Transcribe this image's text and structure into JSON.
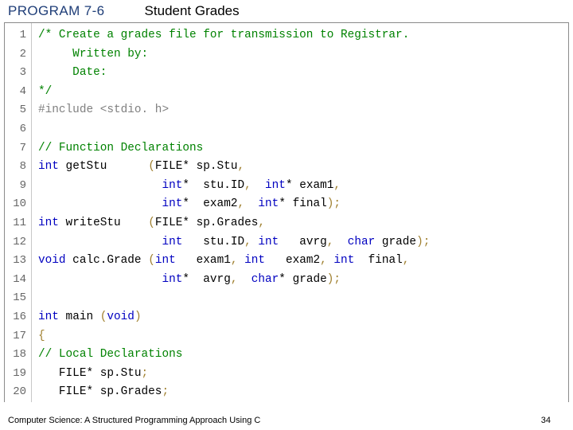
{
  "header": {
    "program_label": "PROGRAM 7-6",
    "title": "Student Grades"
  },
  "code": {
    "line_count": 20,
    "lines": [
      {
        "n": 1,
        "cls": "cmt",
        "text": "/* Create a grades file for transmission to Registrar."
      },
      {
        "n": 2,
        "cls": "cmt",
        "text": "     Written by:"
      },
      {
        "n": 3,
        "cls": "cmt",
        "text": "     Date:"
      },
      {
        "n": 4,
        "cls": "cmt",
        "text": "*/"
      },
      {
        "n": 5,
        "cls": "inc",
        "text": "#include <stdio. h>"
      },
      {
        "n": 6,
        "cls": "",
        "text": ""
      },
      {
        "n": 7,
        "cls": "cmt",
        "text": "// Function Declarations"
      },
      {
        "n": 8,
        "cls": "",
        "html": "<span class='kw'>int</span> getStu      <span class='pn'>(</span>FILE* sp.Stu<span class='pn'>,</span>"
      },
      {
        "n": 9,
        "cls": "",
        "html": "                  <span class='kw'>int</span>*  stu.ID<span class='pn'>,</span>  <span class='kw'>int</span>* exam1<span class='pn'>,</span>"
      },
      {
        "n": 10,
        "cls": "",
        "html": "                  <span class='kw'>int</span>*  exam2<span class='pn'>,</span>  <span class='kw'>int</span>* final<span class='pn'>);</span>"
      },
      {
        "n": 11,
        "cls": "",
        "html": "<span class='kw'>int</span> writeStu    <span class='pn'>(</span>FILE* sp.Grades<span class='pn'>,</span>"
      },
      {
        "n": 12,
        "cls": "",
        "html": "                  <span class='kw'>int</span>   stu.ID<span class='pn'>,</span> <span class='kw'>int</span>   avrg<span class='pn'>,</span>  <span class='kw'>char</span> grade<span class='pn'>);</span>"
      },
      {
        "n": 13,
        "cls": "",
        "html": "<span class='kw'>void</span> calc.Grade <span class='pn'>(</span><span class='kw'>int</span>   exam1<span class='pn'>,</span> <span class='kw'>int</span>   exam2<span class='pn'>,</span> <span class='kw'>int</span>  final<span class='pn'>,</span>"
      },
      {
        "n": 14,
        "cls": "",
        "html": "                  <span class='kw'>int</span>*  avrg<span class='pn'>,</span>  <span class='kw'>char</span>* grade<span class='pn'>);</span>"
      },
      {
        "n": 15,
        "cls": "",
        "text": ""
      },
      {
        "n": 16,
        "cls": "",
        "html": "<span class='kw'>int</span> main <span class='pn'>(</span><span class='kw'>void</span><span class='pn'>)</span>"
      },
      {
        "n": 17,
        "cls": "pn",
        "text": "{"
      },
      {
        "n": 18,
        "cls": "cmt",
        "text": "// Local Declarations"
      },
      {
        "n": 19,
        "cls": "",
        "html": "   FILE* sp.Stu<span class='pn'>;</span>"
      },
      {
        "n": 20,
        "cls": "",
        "html": "   FILE* sp.Grades<span class='pn'>;</span>"
      }
    ]
  },
  "footer": {
    "book": "Computer Science: A Structured Programming Approach Using C",
    "page": "34"
  }
}
